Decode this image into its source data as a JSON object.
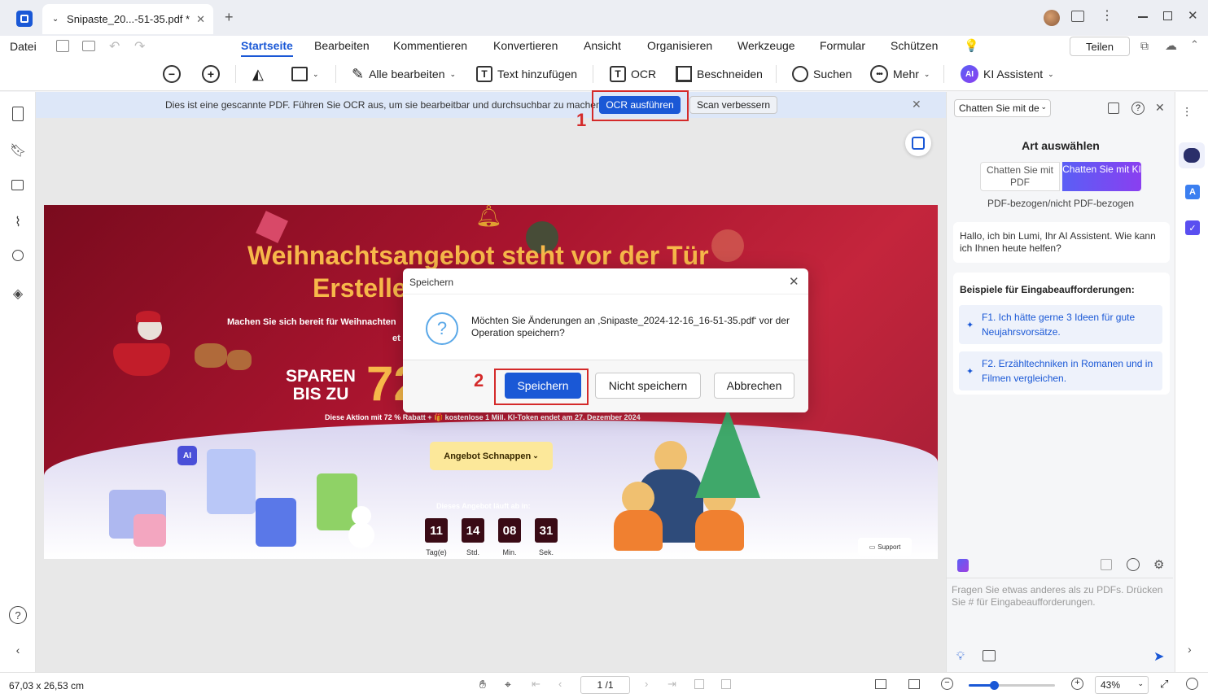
{
  "window": {
    "tab_title": "Snipaste_20...-51-35.pdf *"
  },
  "menu": {
    "file": "Datei",
    "tabs": [
      "Startseite",
      "Bearbeiten",
      "Kommentieren",
      "Konvertieren",
      "Ansicht",
      "Organisieren",
      "Werkzeuge",
      "Formular",
      "Schützen"
    ],
    "share": "Teilen"
  },
  "toolbar": {
    "edit_all": "Alle bearbeiten",
    "add_text": "Text hinzufügen",
    "ocr": "OCR",
    "crop": "Beschneiden",
    "search": "Suchen",
    "more": "Mehr",
    "ai": "KI Assistent",
    "ai_badge": "AI"
  },
  "ocrbar": {
    "message": "Dies ist eine gescannte PDF. Führen Sie OCR aus, um sie bearbeitbar und durchsuchbar zu machen.",
    "run_ocr": "OCR ausführen",
    "improve": "Scan verbessern"
  },
  "banner": {
    "headline": "Weihnachtsangebot steht vor der Tür",
    "line2": "Erstelle",
    "sub": "Machen Sie sich bereit für Weihnachten",
    "sub2": "et",
    "sparen": "SPAREN",
    "bis": "BIS ZU",
    "pct": "72",
    "promo": "Diese Aktion mit 72 % Rabatt + 🎁 kostenlose 1 Mill. KI-Token endet am 27. Dezember 2024",
    "cta": "Angebot Schnappen",
    "countdown_label": "Dieses Angebot läuft ab in:",
    "countdown": [
      {
        "v": "11",
        "l": "Tag(e)"
      },
      {
        "v": "14",
        "l": "Std."
      },
      {
        "v": "08",
        "l": "Min."
      },
      {
        "v": "31",
        "l": "Sek."
      }
    ],
    "support": "Support",
    "ai_tag": "AI"
  },
  "dialog": {
    "title": "Speichern",
    "message": "Möchten Sie Änderungen an ‚Snipaste_2024-12-16_16-51-35.pdf‘ vor der Operation speichern?",
    "save": "Speichern",
    "dont_save": "Nicht speichern",
    "cancel": "Abbrechen"
  },
  "annotations": {
    "one": "1",
    "two": "2"
  },
  "panel": {
    "mode_select": "Chatten Sie mit de",
    "heading": "Art auswählen",
    "opt_pdf": "Chatten Sie mit PDF",
    "opt_ai": "Chatten Sie mit KI",
    "subtitle": "PDF-bezogen/nicht PDF-bezogen",
    "greeting": "Hallo, ich bin Lumi, Ihr AI Assistent. Wie kann ich Ihnen heute helfen?",
    "examples_title": "Beispiele für Eingabeaufforderungen:",
    "ex1": "F1. Ich hätte gerne 3 Ideen für gute Neujahrsvorsätze.",
    "ex2": "F2. Erzähltechniken in Romanen und in Filmen vergleichen.",
    "input_placeholder": "Fragen Sie etwas anderes als zu PDFs. Drücken Sie # für Eingabeaufforderungen."
  },
  "status": {
    "dimensions": "67,03 x 26,53 cm",
    "page": "1 /1",
    "zoom": "43%"
  },
  "colors": {
    "accent": "#1a58d6",
    "annotation": "#d42a2a",
    "ai_gradient": "#7b3ff2"
  }
}
